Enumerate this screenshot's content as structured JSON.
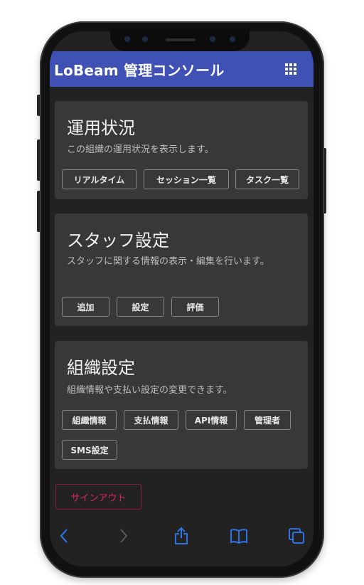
{
  "app": {
    "title": "LoBeam 管理コンソール",
    "accent": "#3f51b5"
  },
  "cards": [
    {
      "title": "運用状況",
      "description": "この組織の運用状況を表示します。",
      "buttons": [
        "リアルタイム",
        "セッション一覧",
        "タスク一覧"
      ]
    },
    {
      "title": "スタッフ設定",
      "description": "スタッフに関する情報の表示・編集を行います。",
      "buttons": [
        "追加",
        "設定",
        "評価"
      ]
    },
    {
      "title": "組織設定",
      "description": "組織情報や支払い設定の変更できます。",
      "buttons": [
        "組織情報",
        "支払情報",
        "API情報",
        "管理者",
        "SMS設定"
      ]
    }
  ],
  "signout_label": "サインアウト",
  "toolbar": {
    "icons": [
      "back-icon",
      "forward-icon",
      "share-icon",
      "bookmarks-icon",
      "tabs-icon"
    ],
    "color": "#2f7bf6"
  }
}
